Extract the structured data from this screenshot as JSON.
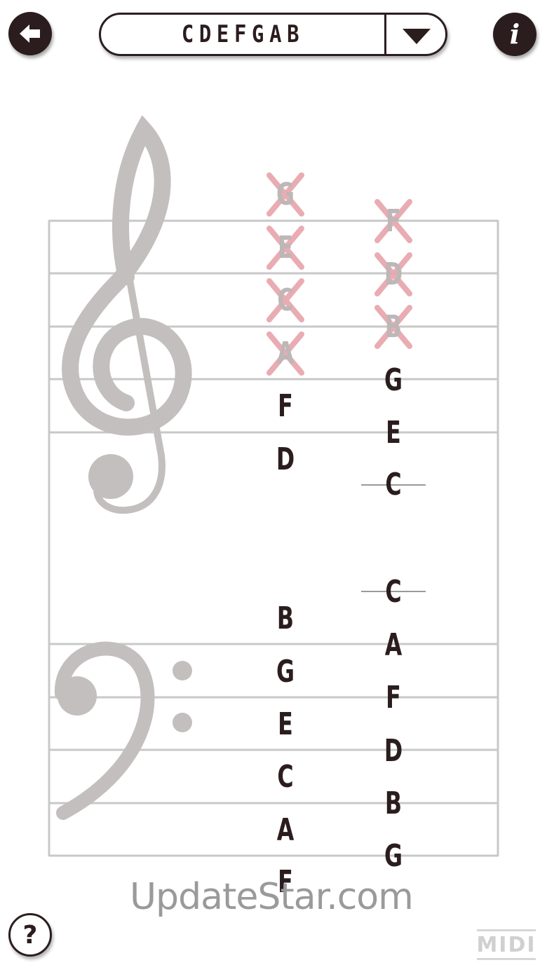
{
  "header": {
    "back_icon": "arrow-left-icon",
    "selector_value": "CDEFGAB",
    "dropdown_icon": "triangle-down-icon",
    "info_icon": "info-icon",
    "info_glyph": "i"
  },
  "treble": {
    "column1_crossed": [
      "G",
      "E",
      "C",
      "A"
    ],
    "column1": [
      "F",
      "D"
    ],
    "column2_crossed": [
      "F",
      "D",
      "B"
    ],
    "column2": [
      "G",
      "E",
      "C"
    ]
  },
  "bass": {
    "column1": [
      "B",
      "G",
      "E",
      "C",
      "A",
      "F"
    ],
    "column2": [
      "C",
      "A",
      "F",
      "D",
      "B",
      "G"
    ]
  },
  "watermark": "UpdateStar.com",
  "footer": {
    "help_glyph": "?",
    "midi_label": "MIDI"
  },
  "colors": {
    "dark": "#2b1d1e",
    "staff": "#c8c8c8",
    "clef": "#c3bfbe",
    "cross": "#e7a4ab"
  }
}
